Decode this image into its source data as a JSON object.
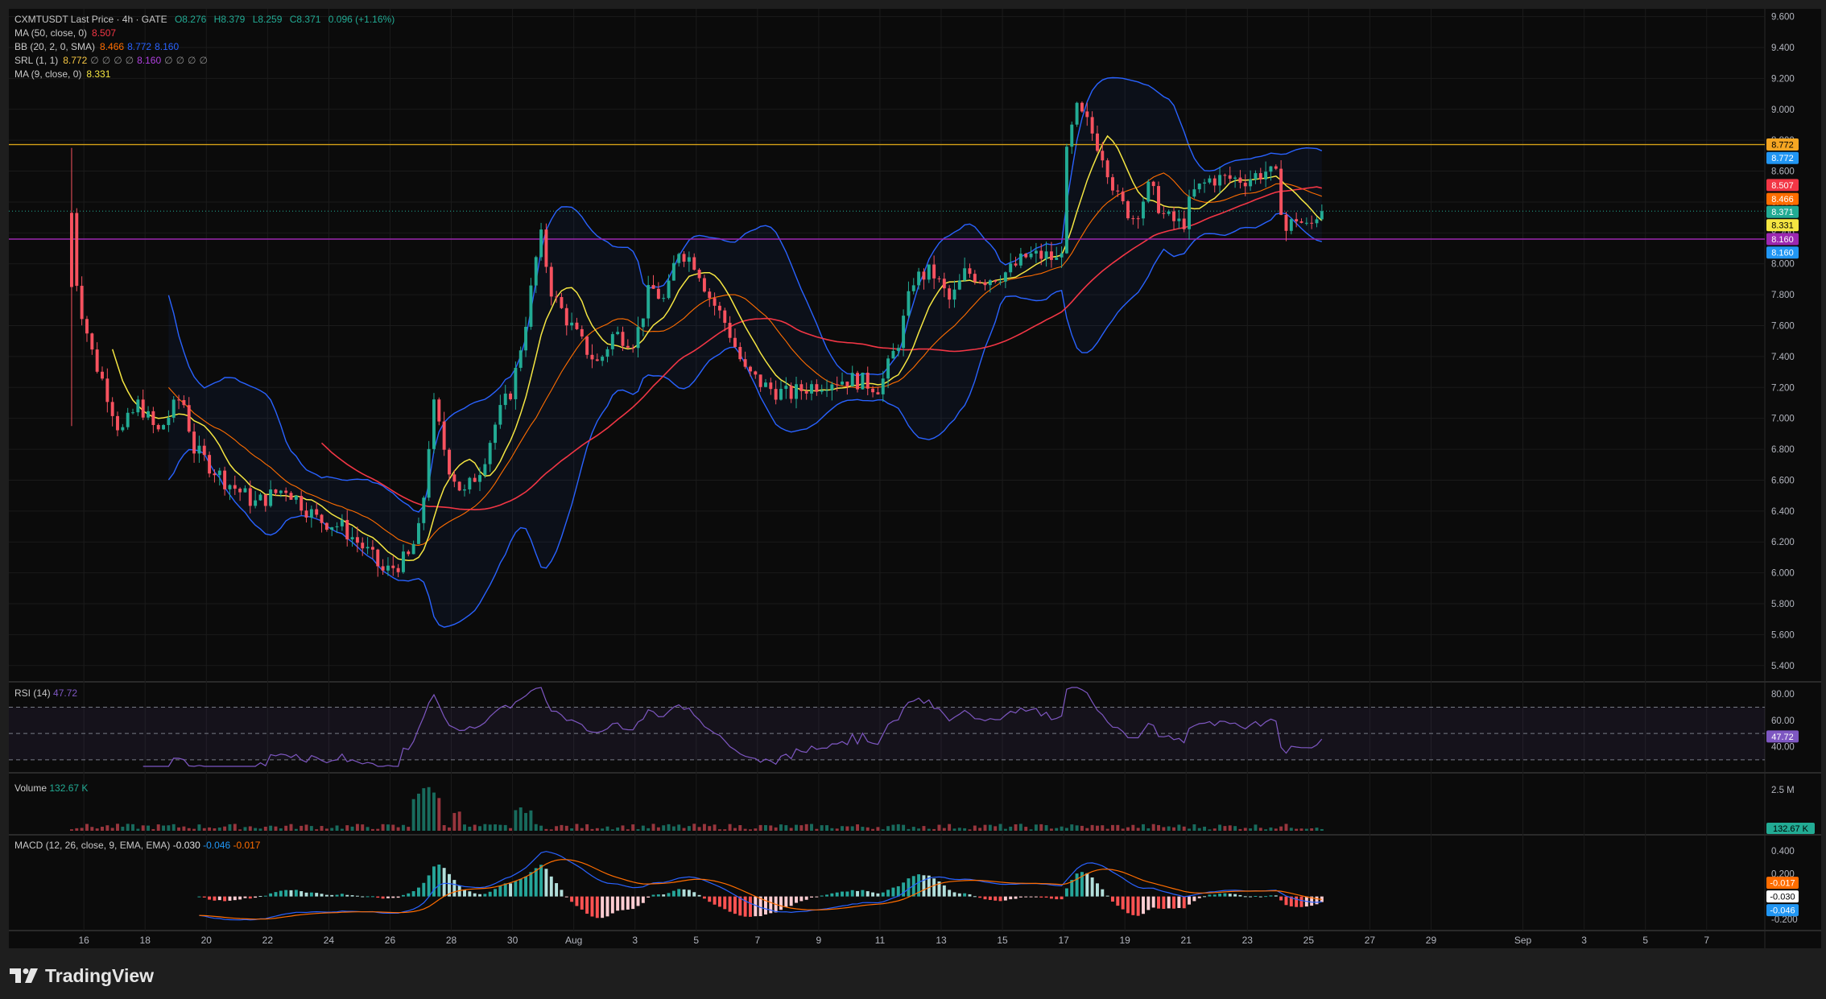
{
  "header": {
    "symbol": "CXMTUSDT Last Price · 4h · GATE",
    "ohlc": [
      "O8.276",
      "H8.379",
      "L8.259",
      "C8.371",
      "0.096 (+1.16%)"
    ],
    "indicators": [
      {
        "label": "MA (50, close, 0)",
        "values": [
          "8.507"
        ],
        "colors": [
          "#f23645"
        ]
      },
      {
        "label": "BB (20, 2, 0, SMA)",
        "values": [
          "8.466",
          "8.772",
          "8.160"
        ],
        "colors": [
          "#ff6d00",
          "#2962ff",
          "#2962ff"
        ]
      },
      {
        "label": "SRL (1, 1)",
        "values": [
          "8.772",
          "∅",
          "∅",
          "∅",
          "∅",
          "8.160",
          "∅",
          "∅",
          "∅",
          "∅"
        ],
        "colors": [
          "#f5c542",
          "#888888",
          "#888888",
          "#888888",
          "#888888",
          "#b040e0",
          "#888888",
          "#888888",
          "#888888",
          "#888888"
        ]
      },
      {
        "label": "MA (9, close, 0)",
        "values": [
          "8.331"
        ],
        "colors": [
          "#f5e642"
        ]
      }
    ]
  },
  "colors": {
    "up": "#22ab94",
    "down": "#f7525f",
    "background": "#0b0b0b",
    "frame": "#1e1e1e",
    "grid": "#1b1b1b"
  },
  "chart_data": {
    "type": "candlestick",
    "timeframe": "4h",
    "exchange": "GATE",
    "symbol": "CXMTUSDT",
    "price_axis": {
      "ticks": [
        "9.600",
        "9.400",
        "9.200",
        "9.000",
        "8.800",
        "8.600",
        "8.400",
        "8.200",
        "8.000",
        "7.800",
        "7.600",
        "7.400",
        "7.200",
        "7.000",
        "6.800",
        "6.600",
        "6.400",
        "6.200",
        "6.000",
        "5.800",
        "5.600",
        "5.400"
      ],
      "ylim": [
        5.3,
        9.65
      ]
    },
    "x_axis": {
      "ticks": [
        {
          "label": "16",
          "day": 16
        },
        {
          "label": "18",
          "day": 18
        },
        {
          "label": "20",
          "day": 20
        },
        {
          "label": "22",
          "day": 22
        },
        {
          "label": "24",
          "day": 24
        },
        {
          "label": "26",
          "day": 26
        },
        {
          "label": "28",
          "day": 28
        },
        {
          "label": "30",
          "day": 30
        },
        {
          "label": "Aug",
          "day": 32
        },
        {
          "label": "3",
          "day": 34
        },
        {
          "label": "5",
          "day": 36
        },
        {
          "label": "7",
          "day": 38
        },
        {
          "label": "9",
          "day": 40
        },
        {
          "label": "11",
          "day": 42
        },
        {
          "label": "13",
          "day": 44
        },
        {
          "label": "15",
          "day": 46
        },
        {
          "label": "17",
          "day": 48
        },
        {
          "label": "19",
          "day": 50
        },
        {
          "label": "21",
          "day": 52
        },
        {
          "label": "23",
          "day": 54
        },
        {
          "label": "25",
          "day": 56
        },
        {
          "label": "27",
          "day": 58
        },
        {
          "label": "29",
          "day": 60
        },
        {
          "label": "Sep",
          "day": 63
        },
        {
          "label": "3",
          "day": 65
        },
        {
          "label": "5",
          "day": 67
        },
        {
          "label": "7",
          "day": 69
        }
      ],
      "range_days": [
        13.55,
        70.9
      ]
    },
    "horizontal_lines": [
      {
        "price": 8.772,
        "color": "#d4a017"
      },
      {
        "price": 8.16,
        "color": "#9c27b0"
      }
    ],
    "price_labels": [
      {
        "text": "8.772",
        "price": 8.772,
        "bg": "#f5a623",
        "fg": "#000000"
      },
      {
        "text": "8.772",
        "price": 8.685,
        "bg": "#2196f3",
        "fg": "#ffffff"
      },
      {
        "text": "8.507",
        "price": 8.51,
        "bg": "#f23645",
        "fg": "#ffffff"
      },
      {
        "text": "8.466",
        "price": 8.42,
        "bg": "#ff6d00",
        "fg": "#ffffff"
      },
      {
        "text": "8.371",
        "price": 8.336,
        "bg": "#22ab94",
        "fg": "#ffffff"
      },
      {
        "text": "8.331",
        "price": 8.25,
        "bg": "#f5e642",
        "fg": "#000000"
      },
      {
        "text": "8.160",
        "price": 8.16,
        "bg": "#9c27b0",
        "fg": "#ffffff"
      },
      {
        "text": "8.160",
        "price": 8.073,
        "bg": "#2196f3",
        "fg": "#ffffff"
      }
    ],
    "path_points": [
      [
        15.6,
        8.33
      ],
      [
        15.8,
        7.8
      ],
      [
        16.3,
        7.4
      ],
      [
        16.7,
        7.2
      ],
      [
        17.2,
        6.9
      ],
      [
        17.8,
        7.1
      ],
      [
        18.4,
        6.9
      ],
      [
        19.2,
        7.15
      ],
      [
        19.6,
        6.8
      ],
      [
        20.6,
        6.6
      ],
      [
        21.6,
        6.45
      ],
      [
        22.6,
        6.55
      ],
      [
        23.6,
        6.35
      ],
      [
        24.4,
        6.3
      ],
      [
        25.2,
        6.15
      ],
      [
        25.8,
        6.0
      ],
      [
        26.6,
        6.1
      ],
      [
        27.0,
        6.3
      ],
      [
        27.4,
        7.1
      ],
      [
        27.9,
        6.7
      ],
      [
        28.4,
        6.5
      ],
      [
        29.0,
        6.7
      ],
      [
        29.5,
        7.0
      ],
      [
        30.0,
        7.2
      ],
      [
        30.5,
        7.7
      ],
      [
        30.9,
        8.2
      ],
      [
        31.3,
        7.8
      ],
      [
        32.2,
        7.5
      ],
      [
        32.8,
        7.35
      ],
      [
        33.3,
        7.55
      ],
      [
        34.0,
        7.5
      ],
      [
        34.5,
        7.85
      ],
      [
        35.0,
        7.75
      ],
      [
        35.4,
        8.1
      ],
      [
        36.0,
        8.0
      ],
      [
        36.4,
        7.8
      ],
      [
        37.0,
        7.6
      ],
      [
        37.6,
        7.3
      ],
      [
        38.3,
        7.2
      ],
      [
        39.0,
        7.15
      ],
      [
        39.6,
        7.2
      ],
      [
        40.4,
        7.25
      ],
      [
        41.2,
        7.25
      ],
      [
        42.0,
        7.2
      ],
      [
        42.6,
        7.5
      ],
      [
        43.1,
        7.9
      ],
      [
        43.7,
        7.95
      ],
      [
        44.3,
        7.75
      ],
      [
        44.8,
        7.95
      ],
      [
        45.4,
        7.9
      ],
      [
        46.2,
        7.95
      ],
      [
        46.8,
        8.05
      ],
      [
        47.5,
        8.05
      ],
      [
        47.9,
        8.0
      ],
      [
        48.1,
        8.7
      ],
      [
        48.4,
        9.0
      ],
      [
        48.8,
        8.9
      ],
      [
        49.3,
        8.7
      ],
      [
        49.8,
        8.4
      ],
      [
        50.3,
        8.3
      ],
      [
        50.8,
        8.5
      ],
      [
        51.3,
        8.3
      ],
      [
        51.9,
        8.25
      ],
      [
        52.2,
        8.45
      ],
      [
        52.8,
        8.55
      ],
      [
        53.4,
        8.55
      ],
      [
        54.0,
        8.55
      ],
      [
        54.6,
        8.6
      ],
      [
        55.0,
        8.55
      ],
      [
        55.2,
        8.2
      ],
      [
        55.6,
        8.3
      ],
      [
        56.0,
        8.22
      ],
      [
        56.4,
        8.37
      ]
    ],
    "volume_pane": {
      "label": "Volume",
      "value": "132.67 K",
      "ticks": [
        "2.5 M"
      ],
      "volume_bg": "#22ab94"
    },
    "rsi_pane": {
      "label": "RSI (14)",
      "value": "47.72",
      "ticks": [
        "80.00",
        "60.00",
        "40.00"
      ],
      "levels": [
        70,
        50,
        30
      ],
      "color": "#7e57c2"
    },
    "macd_pane": {
      "label": "MACD (12, 26, close, 9, EMA, EMA)",
      "values": [
        "-0.030",
        "-0.046",
        "-0.017"
      ],
      "value_colors": [
        "#e0e0e0",
        "#2196f3",
        "#ff6d00"
      ],
      "ticks": [
        "0.400",
        "0.200",
        "0.000",
        "-0.200"
      ],
      "labels": [
        {
          "text": "-0.017",
          "bg": "#ff6d00",
          "fg": "#ffffff"
        },
        {
          "text": "-0.030",
          "bg": "#ffffff",
          "fg": "#000000"
        },
        {
          "text": "-0.046",
          "bg": "#2196f3",
          "fg": "#ffffff"
        }
      ]
    }
  },
  "brand": {
    "name": "TradingView"
  }
}
